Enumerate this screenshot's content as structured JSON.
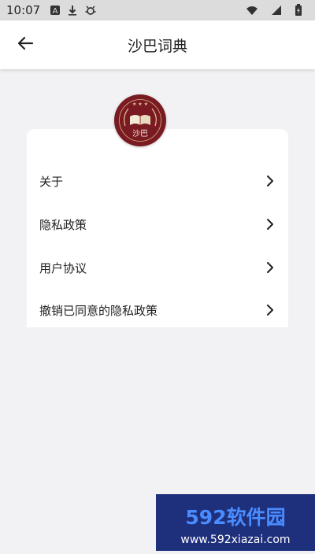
{
  "status_bar": {
    "time": "10:07",
    "icons_left": [
      "a-icon",
      "download-icon",
      "bug-icon"
    ],
    "icons_right": [
      "wifi-icon",
      "signal-icon",
      "battery-icon"
    ]
  },
  "app_bar": {
    "title": "沙巴词典",
    "back_icon": "back-arrow-icon"
  },
  "logo": {
    "text": "沙巴",
    "bg_color": "#7a1a22"
  },
  "menu": {
    "items": [
      {
        "label": "关于"
      },
      {
        "label": "隐私政策"
      },
      {
        "label": "用户协议"
      },
      {
        "label": "撤销已同意的隐私政策"
      }
    ]
  },
  "watermark": {
    "brand": "592软件园",
    "url": "www.592xiazai.com"
  }
}
